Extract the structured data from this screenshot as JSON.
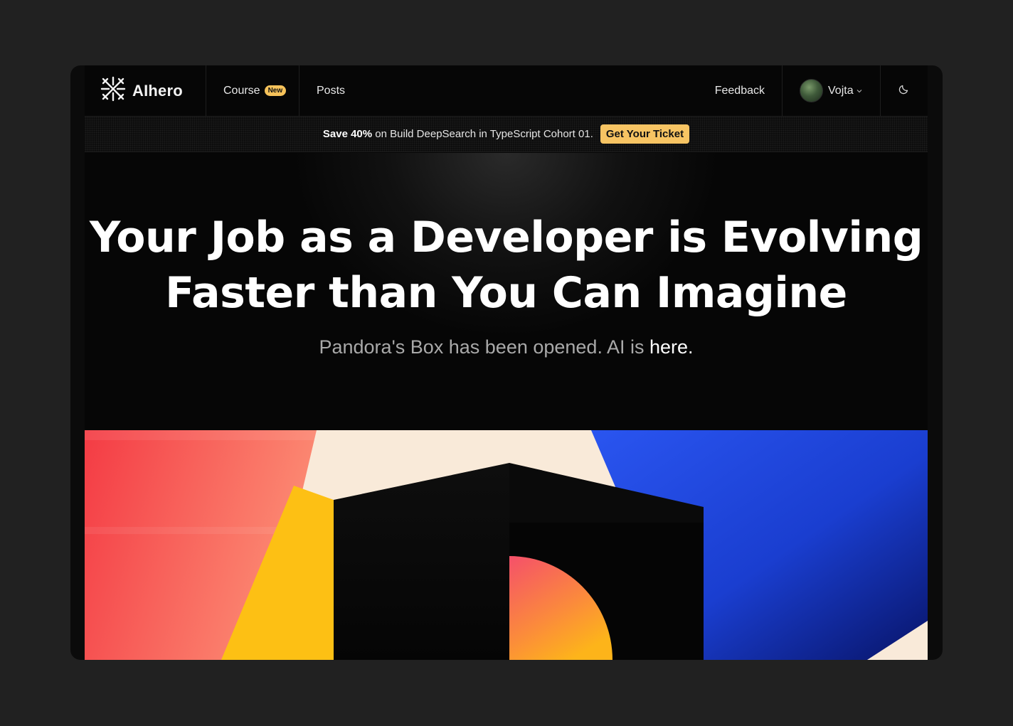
{
  "header": {
    "logo_text": "AIhero",
    "nav": {
      "course_label": "Course",
      "course_badge": "New",
      "posts_label": "Posts",
      "feedback_label": "Feedback"
    },
    "user": {
      "name": "Vojta"
    },
    "icons": {
      "logo": "aihero-logo-icon",
      "theme": "moon-icon",
      "dropdown": "chevron-down-icon"
    }
  },
  "promo": {
    "bold": "Save 40%",
    "text": "on Build DeepSearch in TypeScript Cohort 01.",
    "cta_label": "Get Your Ticket",
    "cta_color": "#f7c463"
  },
  "hero": {
    "title_line1": "Your Job as a Developer is Evolving",
    "title_line2": "Faster than You Can Imagine",
    "subtitle_dim": "Pandora's Box has been opened. AI is ",
    "subtitle_highlight": "here."
  },
  "colors": {
    "page_bg": "#212121",
    "red": "#f44a4a",
    "yellow": "#fdc014",
    "cream": "#f9ead9",
    "blue": "#1e47e0",
    "navy": "#0b1a6e"
  }
}
